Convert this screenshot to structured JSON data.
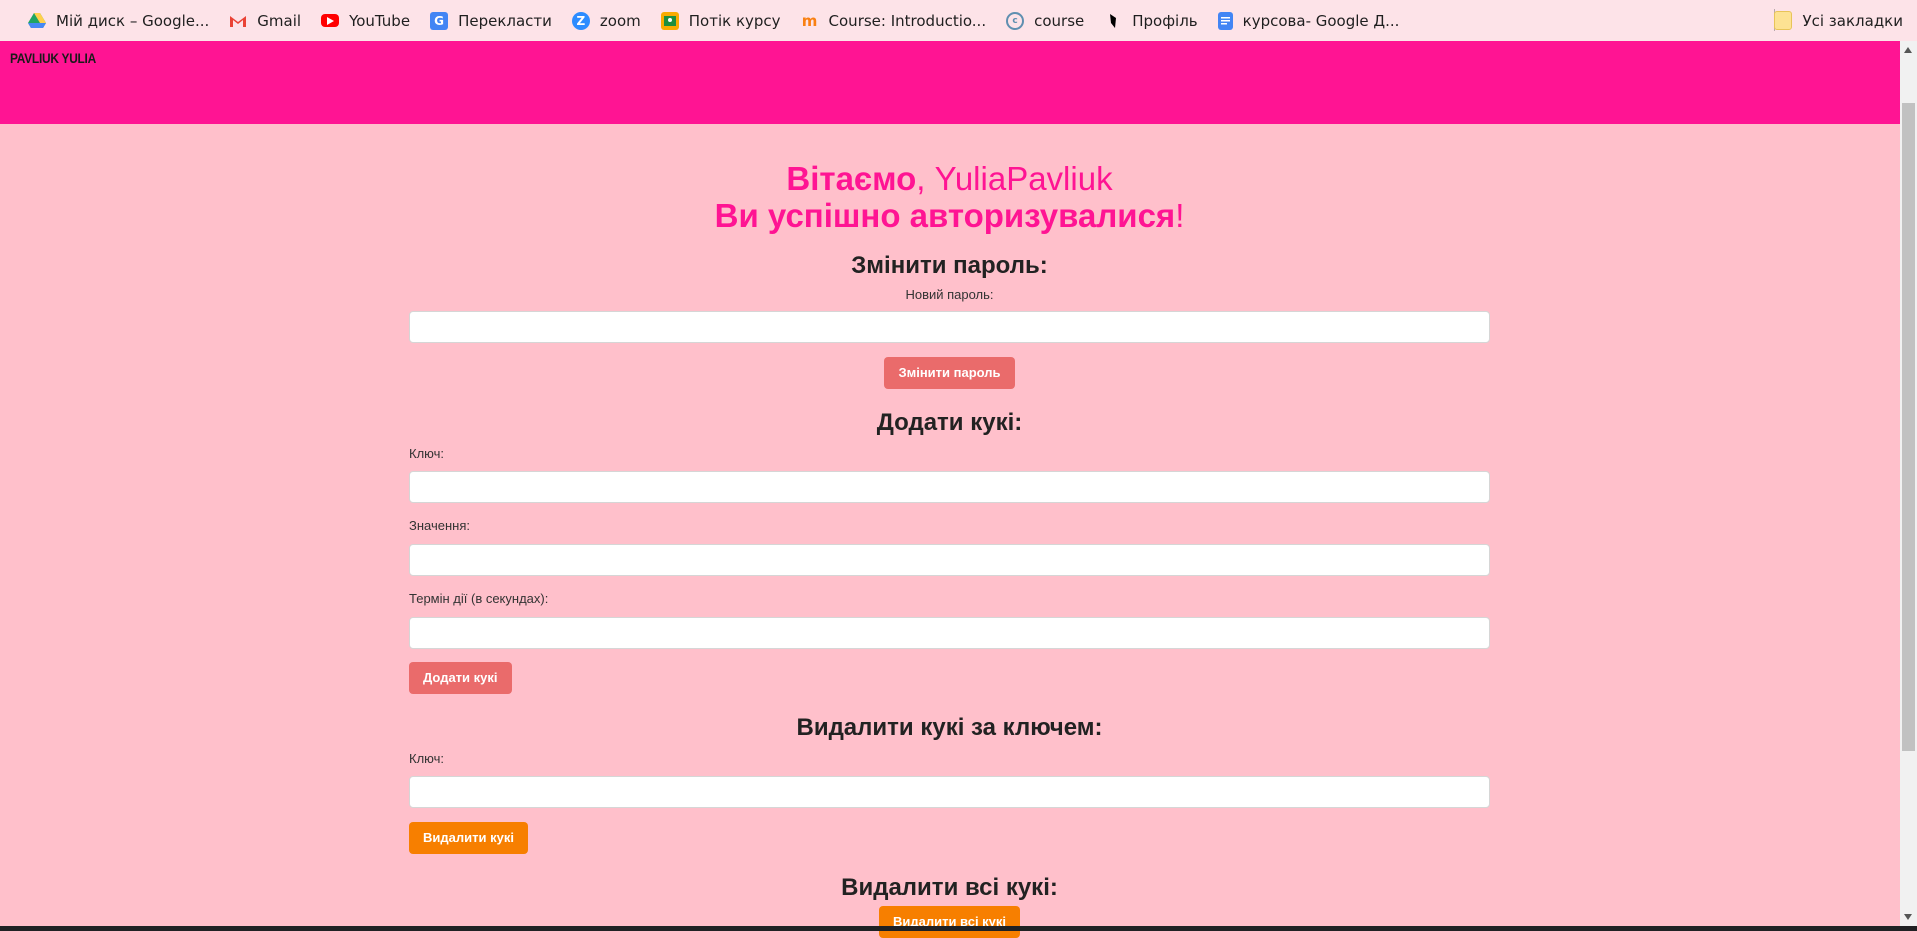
{
  "bookmarks": [
    {
      "label": "Мій диск – Google...",
      "icon": "google-drive-icon",
      "color": "#1fa463"
    },
    {
      "label": "Gmail",
      "icon": "gmail-icon",
      "color": "#ea4335"
    },
    {
      "label": "YouTube",
      "icon": "youtube-icon",
      "color": "#ff0000"
    },
    {
      "label": "Перекласти",
      "icon": "google-translate-icon",
      "color": "#4285f4"
    },
    {
      "label": "zoom",
      "icon": "zoom-icon",
      "color": "#2d8cff"
    },
    {
      "label": "Потік курсу",
      "icon": "classroom-icon",
      "color": "#f9ab00"
    },
    {
      "label": "Course: Introductio...",
      "icon": "moodle-icon",
      "color": "#f98012"
    },
    {
      "label": "course",
      "icon": "course-icon",
      "color": "#5f8fb0"
    },
    {
      "label": "Профіль",
      "icon": "profile-icon",
      "color": "#000000"
    },
    {
      "label": "курсова- Google Д...",
      "icon": "google-docs-icon",
      "color": "#4285f4"
    }
  ],
  "all_bookmarks_label": "Усі закладки",
  "header": {
    "brand": "PAVLIUK YULIA",
    "color": "#ff1493"
  },
  "welcome": {
    "line1_bold": "Вітаємо",
    "line1_rest": ", YuliaPavliuk",
    "line2_bold": "Ви успішно авторизувалися",
    "line2_rest": "!"
  },
  "change_password": {
    "title": "Змінити пароль:",
    "new_password_label": "Новий пароль:",
    "new_password_value": "",
    "button": "Змінити пароль"
  },
  "add_cookie": {
    "title": "Додати кукі:",
    "key_label": "Ключ:",
    "key_value": "",
    "value_label": "Значення:",
    "value_value": "",
    "ttl_label": "Термін дії (в секундах):",
    "ttl_value": "",
    "button": "Додати кукі"
  },
  "delete_cookie": {
    "title": "Видалити кукі за ключем:",
    "key_label": "Ключ:",
    "key_value": "",
    "button": "Видалити кукі"
  },
  "delete_all": {
    "title": "Видалити всі кукі:",
    "button": "Видалити всі кукі"
  },
  "colors": {
    "background": "#ffc0cb",
    "accent": "#ff1493",
    "button_red": "#ea6b6b",
    "button_orange": "#f77f00"
  }
}
